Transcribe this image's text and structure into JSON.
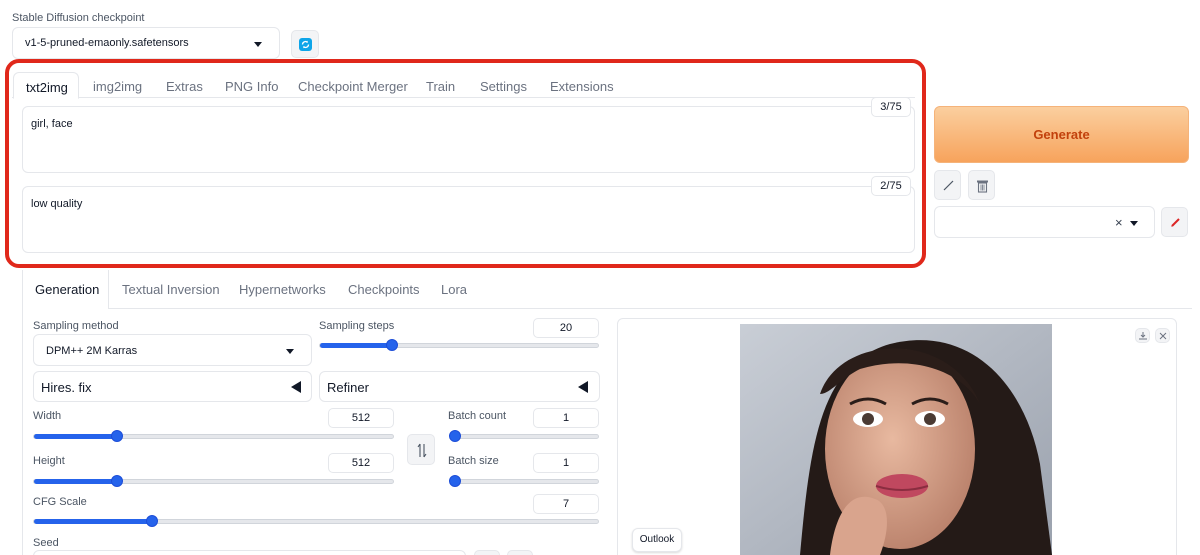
{
  "checkpoint": {
    "label": "Stable Diffusion checkpoint",
    "selected": "v1-5-pruned-emaonly.safetensors",
    "refresh_icon": "refresh-icon"
  },
  "main_tabs": [
    {
      "label": "txt2img",
      "active": true
    },
    {
      "label": "img2img",
      "active": false
    },
    {
      "label": "Extras",
      "active": false
    },
    {
      "label": "PNG Info",
      "active": false
    },
    {
      "label": "Checkpoint Merger",
      "active": false
    },
    {
      "label": "Train",
      "active": false
    },
    {
      "label": "Settings",
      "active": false
    },
    {
      "label": "Extensions",
      "active": false
    }
  ],
  "prompt": {
    "value": "girl, face",
    "token_count": "3/75"
  },
  "negative_prompt": {
    "value": "low quality",
    "token_count": "2/75"
  },
  "generate_button": "Generate",
  "tool_icons": [
    "pencil-line-icon",
    "trash-icon",
    "clear-x-icon",
    "brush-icon"
  ],
  "highlight_color": "#e0281b",
  "generate_color": "#f7a35c",
  "sub_tabs": [
    {
      "label": "Generation",
      "active": true
    },
    {
      "label": "Textual Inversion",
      "active": false
    },
    {
      "label": "Hypernetworks",
      "active": false
    },
    {
      "label": "Checkpoints",
      "active": false
    },
    {
      "label": "Lora",
      "active": false
    }
  ],
  "sampling": {
    "method_label": "Sampling method",
    "method_value": "DPM++ 2M Karras",
    "steps_label": "Sampling steps",
    "steps_value": "20",
    "steps_fraction": 0.26
  },
  "hires_fix_label": "Hires. fix",
  "refiner_label": "Refiner",
  "width": {
    "label": "Width",
    "value": "512",
    "fraction": 0.23
  },
  "height": {
    "label": "Height",
    "value": "512",
    "fraction": 0.23
  },
  "batch_count": {
    "label": "Batch count",
    "value": "1",
    "fraction": 0.0
  },
  "batch_size": {
    "label": "Batch size",
    "value": "1",
    "fraction": 0.0
  },
  "cfg_scale": {
    "label": "CFG Scale",
    "value": "7",
    "fraction": 0.21
  },
  "seed_label": "Seed",
  "swap_icon": "swap-arrows-icon",
  "output": {
    "download_icon": "download-icon",
    "close_icon": "close-icon",
    "outlook_label": "Outlook"
  }
}
